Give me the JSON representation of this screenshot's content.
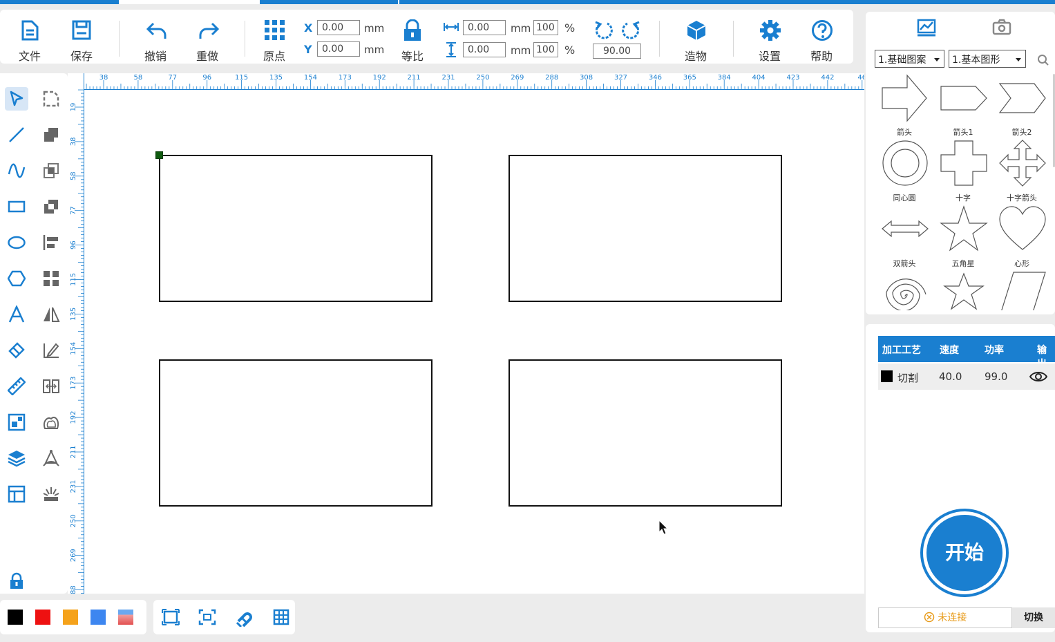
{
  "toolbar": {
    "file": "文件",
    "save": "保存",
    "undo": "撤销",
    "redo": "重做",
    "origin": "原点",
    "x_label": "X",
    "y_label": "Y",
    "x_value": "0.00",
    "y_value": "0.00",
    "unit_mm": "mm",
    "lock_ratio": "等比",
    "width_value": "0.00",
    "height_value": "0.00",
    "width_pct": "100",
    "height_pct": "100",
    "pct": "%",
    "rotate_value": "90.00",
    "build": "造物",
    "settings": "设置",
    "help": "帮助"
  },
  "ruler": {
    "unit": "mm",
    "top_ticks": [
      "38",
      "58",
      "77",
      "96",
      "115",
      "135",
      "154",
      "173",
      "192",
      "211",
      "231",
      "250",
      "269",
      "288",
      "308",
      "327",
      "346",
      "365",
      "384",
      "404",
      "423",
      "442",
      "46"
    ],
    "left_ticks": [
      "19",
      "38",
      "58",
      "77",
      "96",
      "115",
      "135",
      "154",
      "173",
      "192",
      "211",
      "231",
      "250",
      "269",
      "88"
    ]
  },
  "right_panel": {
    "category_select": "1.基础图案",
    "subcategory_select": "1.基本图形",
    "shapes": [
      "箭头",
      "箭头1",
      "箭头2",
      "同心圆",
      "十字",
      "十字箭头",
      "双箭头",
      "五角星",
      "心形"
    ]
  },
  "process": {
    "headers": [
      "加工工艺",
      "速度",
      "功率",
      "输出"
    ],
    "row": {
      "name": "切割",
      "speed": "40.0",
      "power": "99.0",
      "color": "#000000"
    }
  },
  "start_label": "开始",
  "connection_status": "未连接",
  "switch_label": "切换",
  "colors": {
    "accent": "#1a7fd0",
    "swatches": [
      "#000000",
      "#ee1111",
      "#f5a21b",
      "#3d86f0"
    ]
  }
}
